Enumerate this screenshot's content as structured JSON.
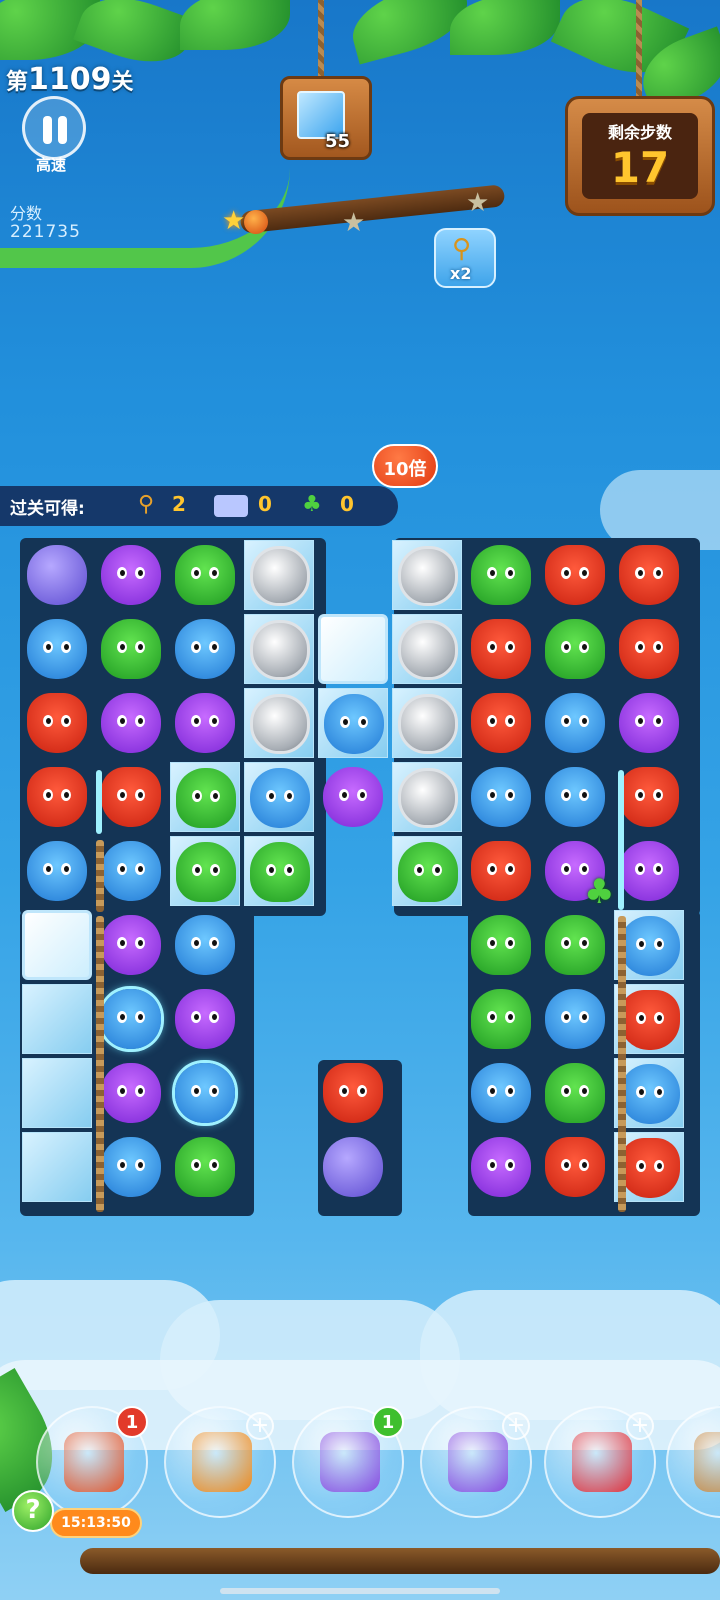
{
  "hud": {
    "level_prefix": "第",
    "level_number": "1109",
    "level_suffix": "关",
    "speed_label": "高速",
    "score_label": "分数",
    "score_value": "221735",
    "progress_stars_lit": 1,
    "progress_stars_total": 3
  },
  "goal": {
    "icon": "ice-block-icon",
    "remaining": "55"
  },
  "moves": {
    "title": "剩余步数",
    "value": "17"
  },
  "racket_bonus": {
    "icon": "racket-icon",
    "multiplier": "x2"
  },
  "rewards": {
    "label": "过关可得:",
    "items": [
      {
        "icon": "racket-icon",
        "value": "2"
      },
      {
        "icon": "ticket-icon",
        "value": "0"
      },
      {
        "icon": "clover-icon",
        "value": "0"
      }
    ],
    "multiplier_badge": "10倍"
  },
  "board": {
    "colors": {
      "fox": "#e0301a",
      "owl": "#9b3de8",
      "frog": "#2fb52f",
      "bear": "#3a9be8",
      "coin": "#c8cdd2"
    }
  },
  "boosters": [
    {
      "name": "shuffle-booster",
      "icon": "shuffle-icon",
      "badge": "1",
      "timer": "15:13:50"
    },
    {
      "name": "extra-moves-booster",
      "icon": "clock-icon",
      "badge": null
    },
    {
      "name": "swap-booster",
      "icon": "swap-icon",
      "badge": "1"
    },
    {
      "name": "horizontal-rocket-booster",
      "icon": "horizontal-rocket-icon",
      "badge": null
    },
    {
      "name": "vertical-rocket-booster",
      "icon": "vertical-rocket-icon",
      "badge": null
    },
    {
      "name": "hammer-booster",
      "icon": "hammer-icon",
      "badge": null
    }
  ],
  "help_label": "?"
}
